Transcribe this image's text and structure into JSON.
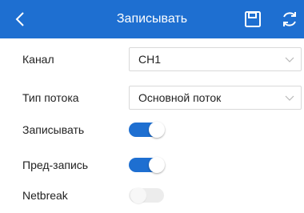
{
  "header": {
    "title": "Записывать",
    "back_icon": "chevron-left-icon",
    "save_icon": "floppy-disk-icon",
    "refresh_icon": "refresh-icon",
    "background": "#1e6fd1"
  },
  "rows": {
    "channel": {
      "label": "Канал",
      "value": "CH1"
    },
    "stream_type": {
      "label": "Тип потока",
      "value": "Основной поток"
    },
    "record": {
      "label": "Записывать",
      "state": "on"
    },
    "prerecord": {
      "label": "Пред-запись",
      "state": "on"
    },
    "netbreak": {
      "label": "Netbreak",
      "state": "off"
    }
  },
  "colors": {
    "accent": "#1e6fd1",
    "toggle_off": "#ececec",
    "border": "#d9d9d9"
  }
}
